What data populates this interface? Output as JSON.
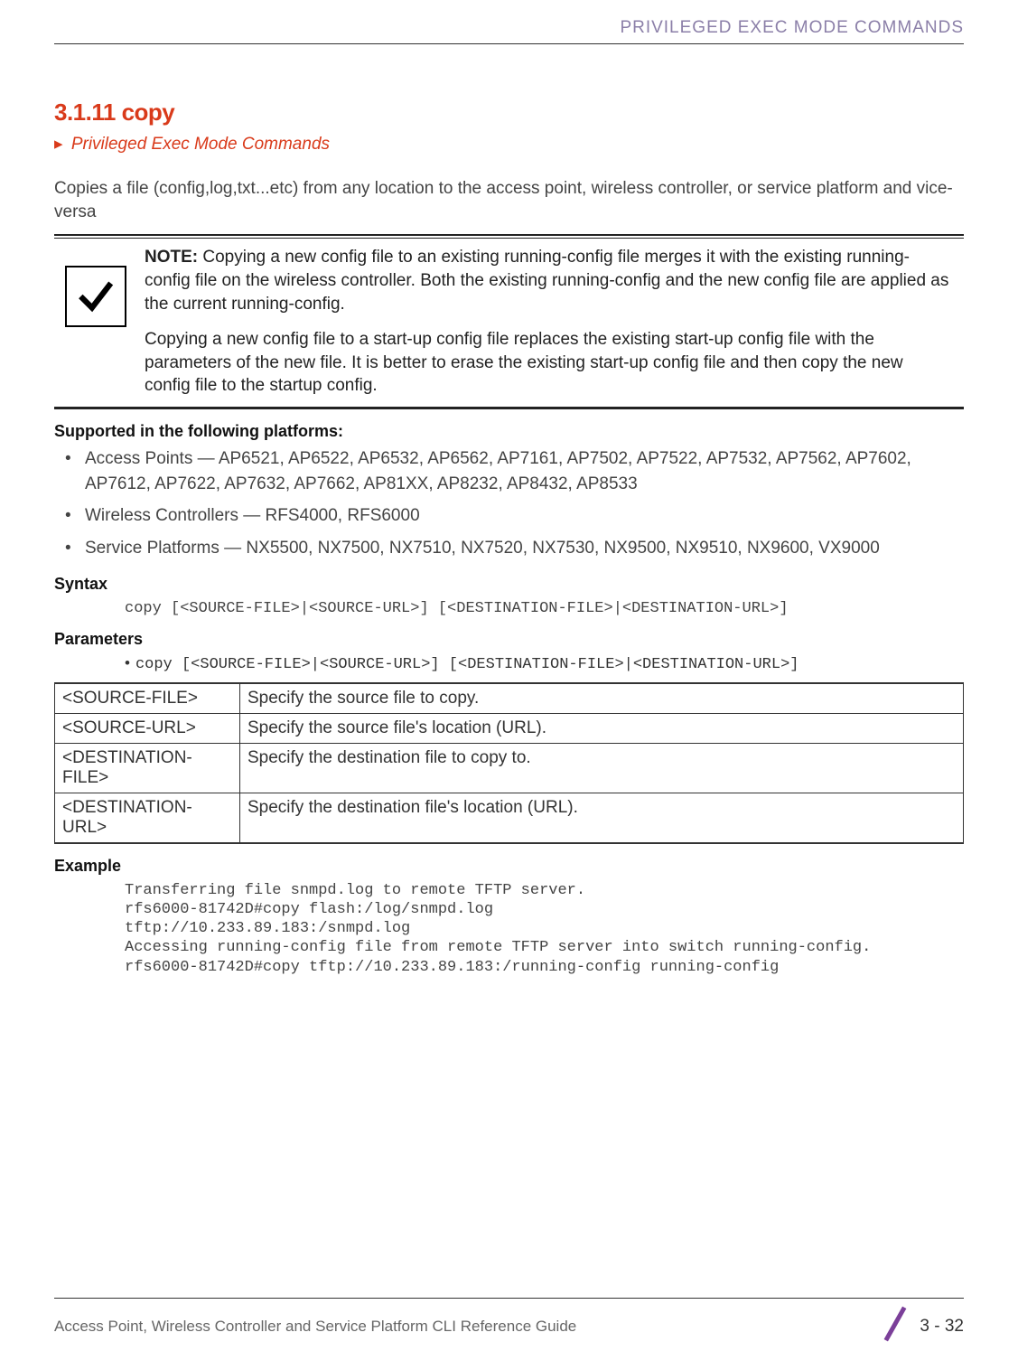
{
  "header": {
    "section": "PRIVILEGED EXEC MODE COMMANDS"
  },
  "title": "3.1.11 copy",
  "breadcrumb": "Privileged Exec Mode Commands",
  "description": "Copies a file (config,log,txt...etc) from any location to the access point, wireless controller, or service platform and vice-versa",
  "note": {
    "label": "NOTE:",
    "p1": " Copying a new config file to an existing running-config file merges it with the existing\nrunning-config file on the wireless controller. Both the existing running-config and the new config file are applied as the current running-config.",
    "p2": "Copying a new config file to a start-up config file replaces the existing start-up config file with the parameters of the new file. It is better to erase the existing start-up config file and then copy the new config file to the startup config."
  },
  "platforms_heading": "Supported in the following platforms:",
  "platforms": [
    "Access Points — AP6521, AP6522, AP6532, AP6562, AP7161, AP7502, AP7522, AP7532, AP7562, AP7602, AP7612, AP7622, AP7632, AP7662, AP81XX, AP8232, AP8432, AP8533",
    "Wireless Controllers — RFS4000, RFS6000",
    "Service Platforms — NX5500, NX7500, NX7510, NX7520, NX7530, NX9500, NX9510, NX9600, VX9000"
  ],
  "syntax": {
    "heading": "Syntax",
    "code": "copy [<SOURCE-FILE>|<SOURCE-URL>] [<DESTINATION-FILE>|<DESTINATION-URL>]"
  },
  "parameters": {
    "heading": "Parameters",
    "line": "copy [<SOURCE-FILE>|<SOURCE-URL>] [<DESTINATION-FILE>|<DESTINATION-URL>]",
    "rows": [
      {
        "k": "<SOURCE-FILE>",
        "v": "Specify the source file to copy."
      },
      {
        "k": "<SOURCE-URL>",
        "v": "Specify the source file's location (URL)."
      },
      {
        "k": "<DESTINATION-FILE>",
        "v": "Specify the destination file to copy to."
      },
      {
        "k": "<DESTINATION-URL>",
        "v": "Specify the destination file's location (URL)."
      }
    ]
  },
  "example": {
    "heading": "Example",
    "code": "Transferring file snmpd.log to remote TFTP server.\nrfs6000-81742D#copy flash:/log/snmpd.log\ntftp://10.233.89.183:/snmpd.log\nAccessing running-config file from remote TFTP server into switch running-config.\nrfs6000-81742D#copy tftp://10.233.89.183:/running-config running-config"
  },
  "footer": {
    "title": "Access Point, Wireless Controller and Service Platform CLI Reference Guide",
    "page": "3 - 32"
  }
}
